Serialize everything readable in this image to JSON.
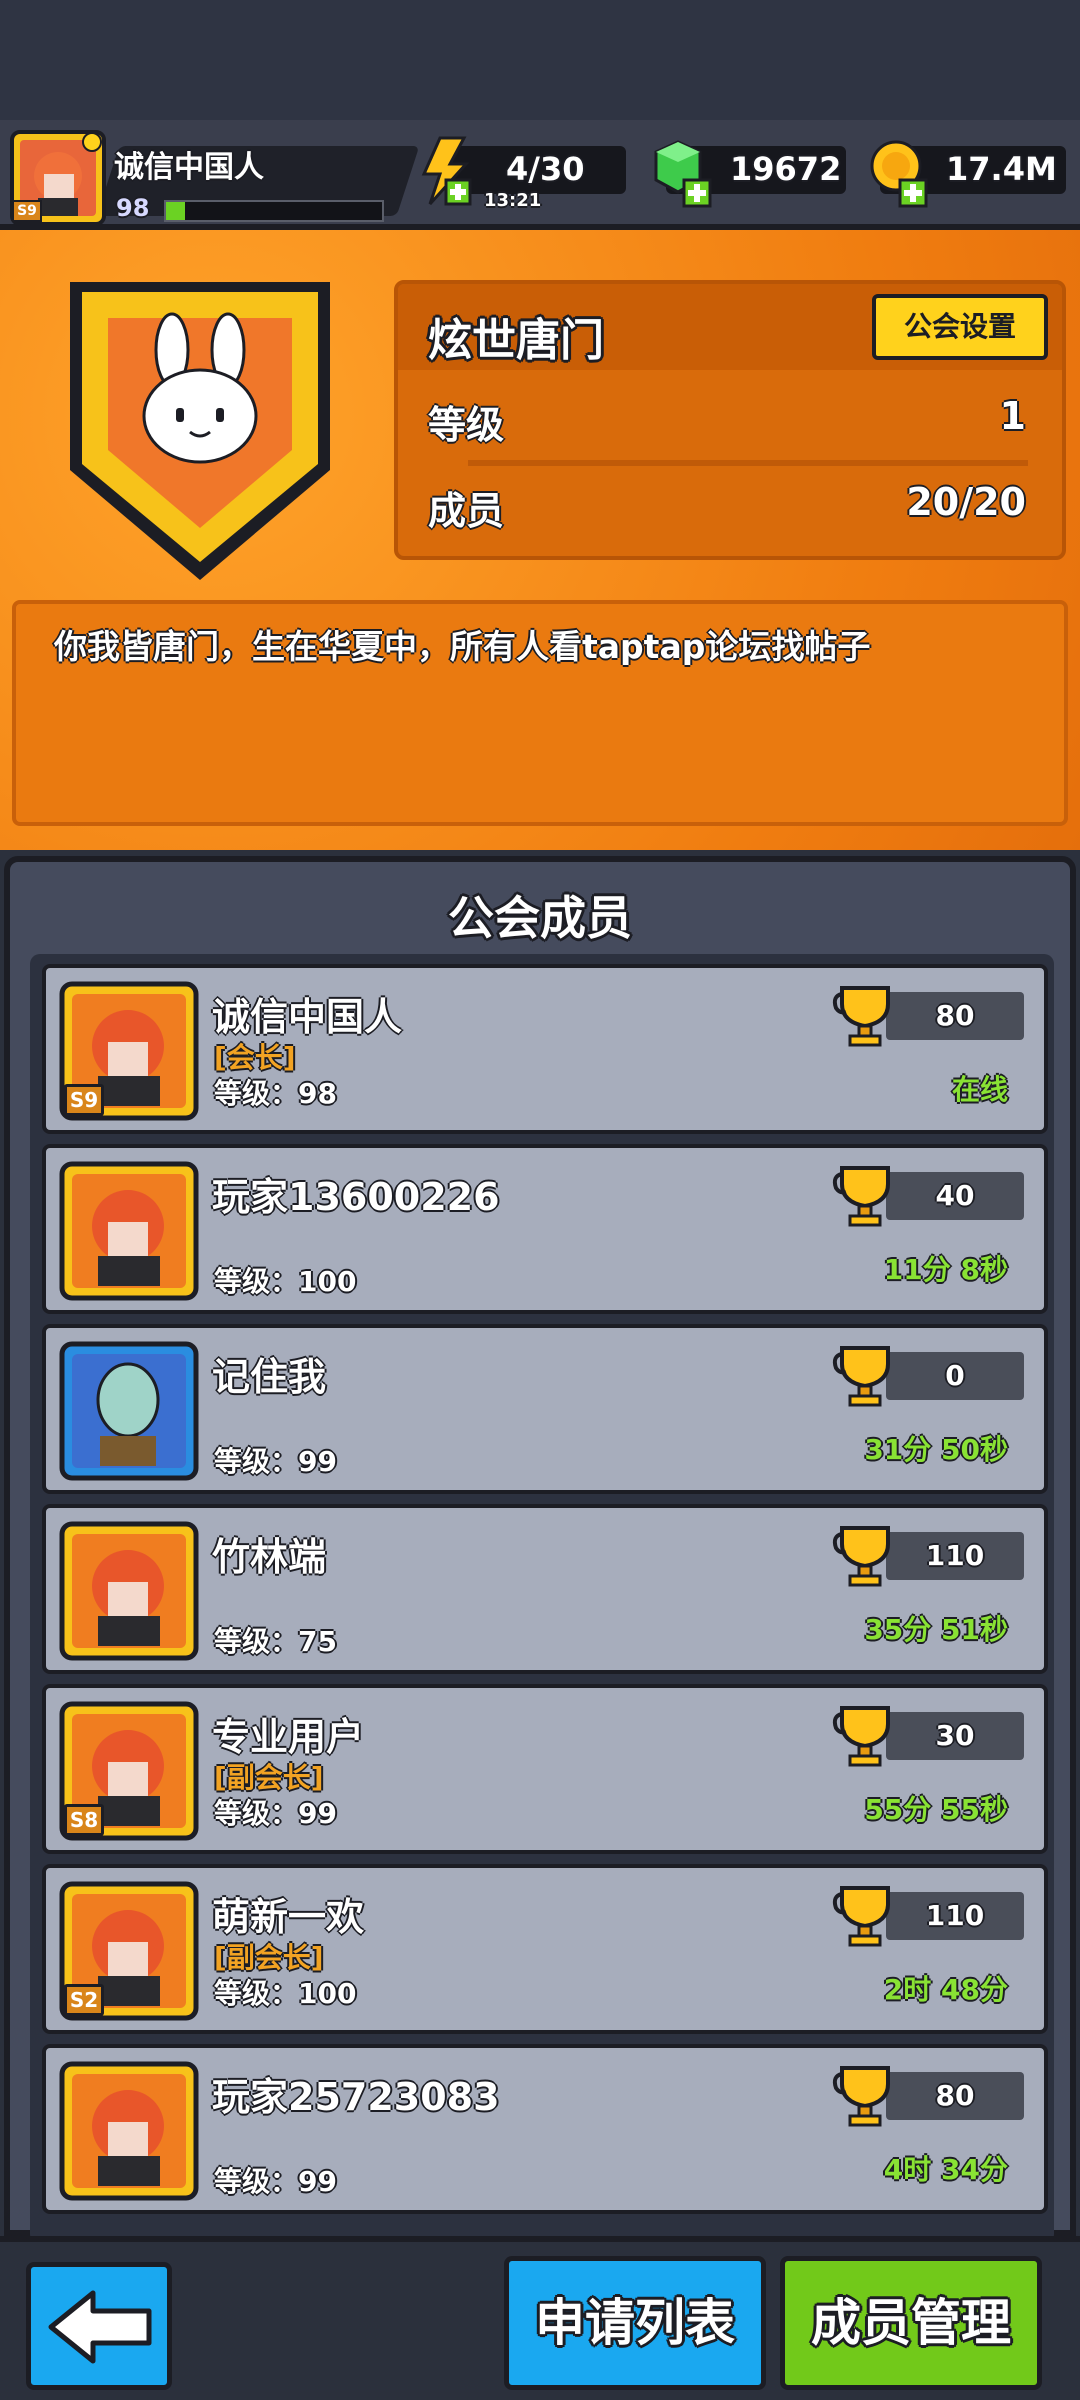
{
  "player": {
    "name": "诚信中国人",
    "level": "98",
    "season_badge": "S9",
    "xp_fraction": 0.09
  },
  "resources": {
    "energy": "4/30",
    "energy_timer": "13:21",
    "gems": "19672",
    "coins": "17.4M"
  },
  "guild": {
    "name": "炫世唐门",
    "settings_label": "公会设置",
    "level_label": "等级",
    "level_value": "1",
    "members_label": "成员",
    "members_value": "20/20",
    "motto": "你我皆唐门，生在华夏中，所有人看taptap论坛找帖子"
  },
  "members_panel": {
    "title": "公会成员",
    "members": [
      {
        "name": "诚信中国人",
        "role": "[会长]",
        "level": "等级：98",
        "trophies": "80",
        "status": "在线",
        "badge": "S9"
      },
      {
        "name": "玩家13600226",
        "role": "",
        "level": "等级：100",
        "trophies": "40",
        "status": "11分 8秒",
        "badge": ""
      },
      {
        "name": "记住我",
        "role": "",
        "level": "等级：99",
        "trophies": "0",
        "status": "31分 50秒",
        "badge": ""
      },
      {
        "name": "竹林端",
        "role": "",
        "level": "等级：75",
        "trophies": "110",
        "status": "35分 51秒",
        "badge": ""
      },
      {
        "name": "专业用户",
        "role": "[副会长]",
        "level": "等级：99",
        "trophies": "30",
        "status": "55分 55秒",
        "badge": "S8"
      },
      {
        "name": "萌新一欢",
        "role": "[副会长]",
        "level": "等级：100",
        "trophies": "110",
        "status": "2时 48分",
        "badge": "S2"
      },
      {
        "name": "玩家25723083",
        "role": "",
        "level": "等级：99",
        "trophies": "80",
        "status": "4时 34分",
        "badge": ""
      }
    ]
  },
  "bottom": {
    "apply_list_label": "申请列表",
    "member_manage_label": "成员管理"
  },
  "colors": {
    "orange": "#f07d10",
    "online_green": "#89e234",
    "role_orange": "#f2a323",
    "blue_button": "#1aa8f0",
    "green_button": "#72c91a"
  }
}
